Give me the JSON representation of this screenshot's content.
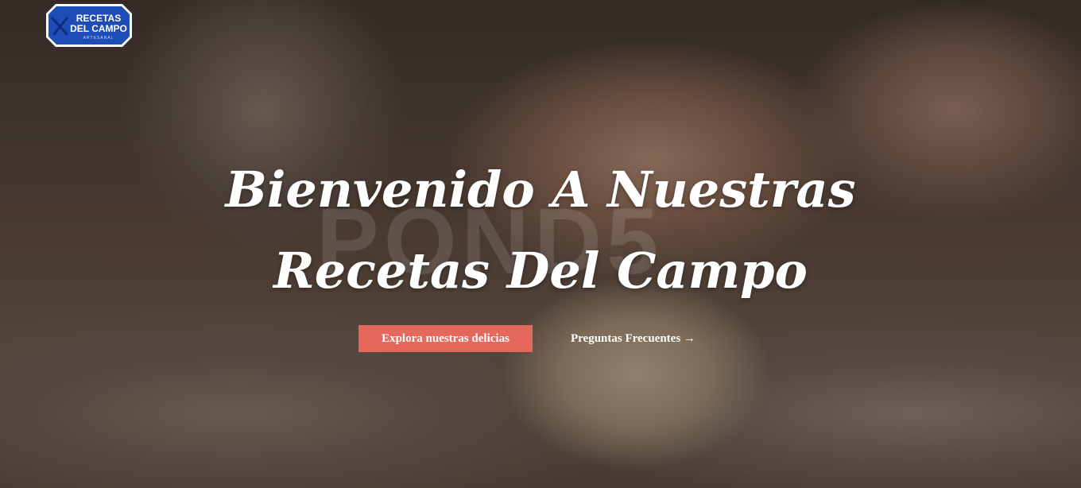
{
  "header": {
    "logo": {
      "line1": "RECETAS",
      "line2": "DEL CAMPO",
      "tagline": "ARTESANAL",
      "brand_color": "#1e4db7",
      "border_color": "#ffffff"
    }
  },
  "hero": {
    "title_line1": "Bienvenido A Nuestras",
    "title_line2": "Recetas Del Campo",
    "watermark": "POND5",
    "primary_cta": "Explora nuestras delicias",
    "secondary_cta": "Preguntas Frecuentes →",
    "accent_color": "#e5685c",
    "background_image": "hands kneading dough on floured table"
  }
}
